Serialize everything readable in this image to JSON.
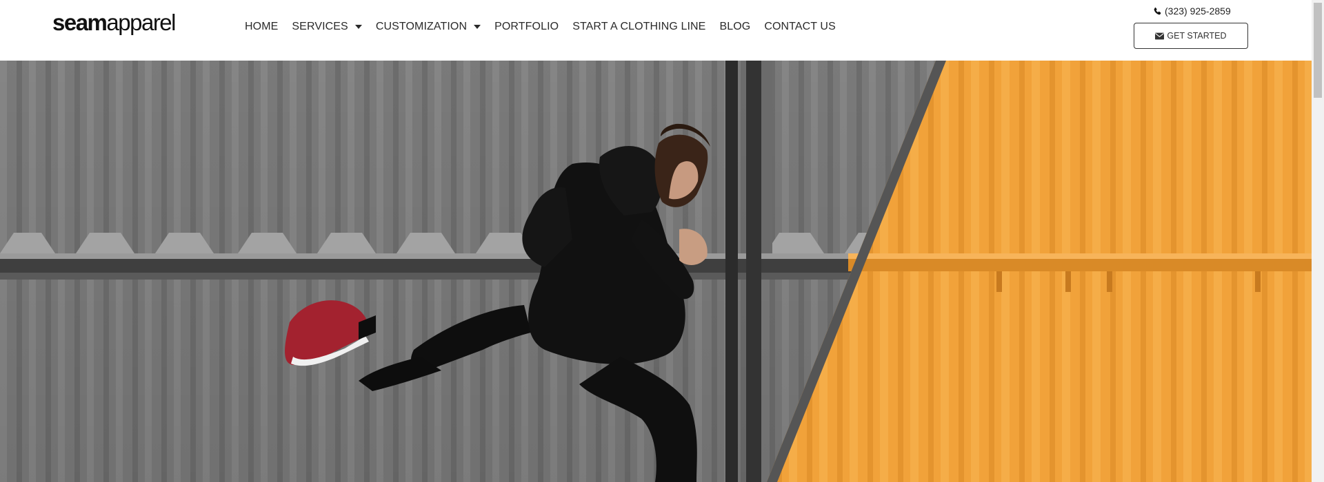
{
  "header": {
    "logo_bold": "seam",
    "logo_light": "apparel",
    "nav": [
      {
        "label": "HOME"
      },
      {
        "label": "SERVICES"
      },
      {
        "label": "CUSTOMIZATION"
      },
      {
        "label": "PORTFOLIO"
      },
      {
        "label": "START A CLOTHING LINE"
      },
      {
        "label": "BLOG"
      },
      {
        "label": "CONTACT US"
      }
    ],
    "phone": "(323) 925-2859",
    "cta_label": "GET STARTED"
  },
  "hero": {
    "accent_color": "#f2a33a",
    "wall_color": "#7f7f7f",
    "icons": [
      "phone-icon",
      "envelope-icon",
      "chevron-down-icon"
    ]
  }
}
